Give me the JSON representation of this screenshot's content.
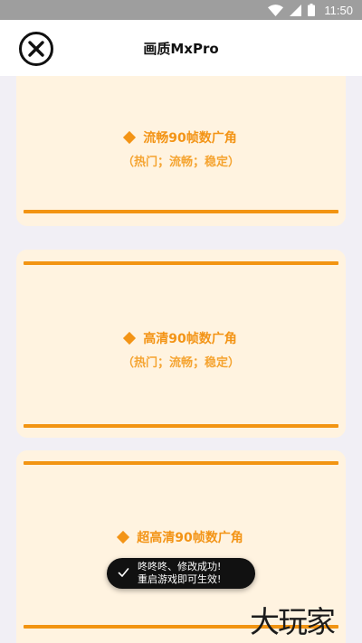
{
  "status_bar": {
    "time": "11:50",
    "icons": [
      "wifi-icon",
      "signal-icon",
      "battery-icon"
    ]
  },
  "header": {
    "title": "画质MxPro",
    "close_icon": "close-circle-icon"
  },
  "cards": [
    {
      "name": "流畅90帧数广角",
      "tags": "（热门；流畅；稳定）"
    },
    {
      "name": "高清90帧数广角",
      "tags": "（热门；流畅；稳定）"
    },
    {
      "name": "超高清90帧数广角",
      "tags": ""
    }
  ],
  "toast": {
    "line1": "咚咚咚、修改成功!",
    "line2": "重启游戏即可生效!"
  },
  "watermark": "大玩家",
  "colors": {
    "accent": "#f39416",
    "card_bg": "#fff3e0",
    "page_bg": "#f1eff5",
    "status_bar": "#9e9e9e"
  }
}
